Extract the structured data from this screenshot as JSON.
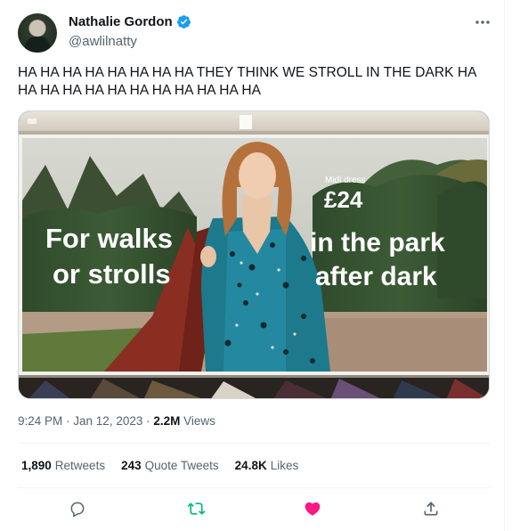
{
  "author": {
    "display_name": "Nathalie Gordon",
    "handle": "@awlilnatty",
    "verified": true
  },
  "tweet": {
    "text": "HA HA HA HA HA HA HA HA THEY THINK WE STROLL IN THE DARK HA HA HA HA HA HA HA HA HA HA HA HA"
  },
  "media": {
    "ad_left_text": [
      "For walks",
      "or strolls"
    ],
    "ad_right_text": [
      "in the park",
      "after dark"
    ],
    "price_label": "Midi dress",
    "price": "£24"
  },
  "meta": {
    "time": "9:24 PM",
    "separator": " · ",
    "date": "Jan 12, 2023",
    "views_count": "2.2M",
    "views_label": "Views"
  },
  "stats": {
    "retweets_count": "1,890",
    "retweets_label": "Retweets",
    "quotes_count": "243",
    "quotes_label": "Quote Tweets",
    "likes_count": "24.8K",
    "likes_label": "Likes"
  },
  "colors": {
    "verified": "#1d9bf0",
    "retweet_active": "#00ba7c",
    "like_active": "#f91880",
    "icon_default": "#536471"
  },
  "icons": [
    "verified-badge-icon",
    "more-icon",
    "reply-icon",
    "retweet-icon",
    "like-icon",
    "share-icon"
  ]
}
